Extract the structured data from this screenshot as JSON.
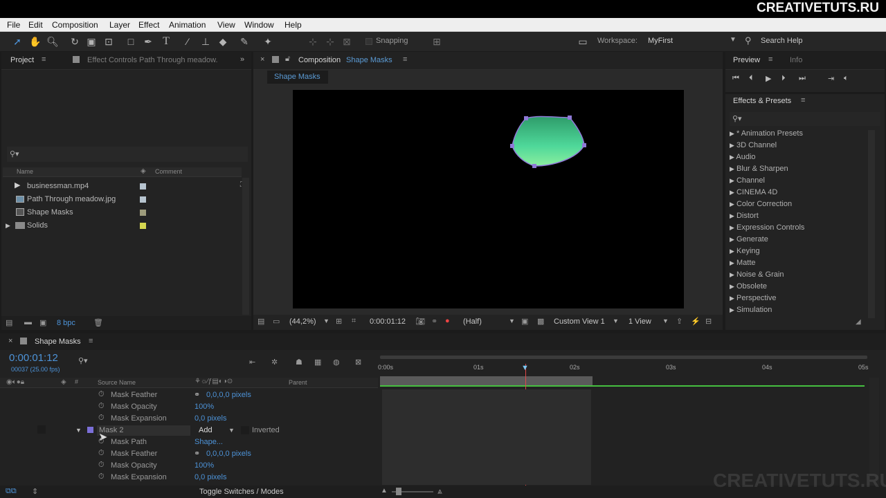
{
  "watermark_top": "CREATIVETUTS.RU",
  "watermark_bottom": "CREATIVETUTS.RU",
  "menu": [
    "File",
    "Edit",
    "Composition",
    "Layer",
    "Effect",
    "Animation",
    "View",
    "Window",
    "Help"
  ],
  "toolbar": {
    "snapping_label": "Snapping",
    "workspace_label": "Workspace:",
    "workspace_value": "MyFirst",
    "search_help": "Search Help"
  },
  "project": {
    "tab_project": "Project",
    "tab_effect_controls": "Effect Controls Path Through meadow.",
    "col_name": "Name",
    "col_comment": "Comment",
    "items": [
      {
        "name": "businessman.mp4",
        "color": "#b7c4cf"
      },
      {
        "name": "Path Through meadow.jpg",
        "color": "#b7c4cf"
      },
      {
        "name": "Shape Masks",
        "color": "#9e9c7c"
      },
      {
        "name": "Solids",
        "color": "#d5d650"
      }
    ],
    "bpc": "8 bpc"
  },
  "composition": {
    "tab_prefix": "Composition",
    "tab_name": "Shape Masks",
    "sub_tab": "Shape Masks",
    "zoom": "(44,2%)",
    "timecode": "0:00:01:12",
    "resolution": "(Half)",
    "view": "Custom View 1",
    "views": "1 View"
  },
  "preview": {
    "tab_preview": "Preview",
    "tab_info": "Info"
  },
  "effects": {
    "title": "Effects & Presets",
    "items": [
      "* Animation Presets",
      "3D Channel",
      "Audio",
      "Blur & Sharpen",
      "Channel",
      "CINEMA 4D",
      "Color Correction",
      "Distort",
      "Expression Controls",
      "Generate",
      "Keying",
      "Matte",
      "Noise & Grain",
      "Obsolete",
      "Perspective",
      "Simulation"
    ]
  },
  "timeline": {
    "tab": "Shape Masks",
    "timecode": "0:00:01:12",
    "fps": "00037 (25.00 fps)",
    "col_source": "Source Name",
    "col_parent": "Parent",
    "ruler": [
      "0:00s",
      "01s",
      "02s",
      "03s",
      "04s",
      "05s"
    ],
    "rows": [
      {
        "label": "Mask Feather",
        "value": "0,0,0,0 pixels"
      },
      {
        "label": "Mask Opacity",
        "value": "100%"
      },
      {
        "label": "Mask Expansion",
        "value": "0,0 pixels"
      }
    ],
    "mask2": {
      "label": "Mask 2",
      "mode": "Add",
      "inverted": "Inverted"
    },
    "rows2": [
      {
        "label": "Mask Path",
        "value": "Shape..."
      },
      {
        "label": "Mask Feather",
        "value": "0,0,0,0 pixels"
      },
      {
        "label": "Mask Opacity",
        "value": "100%"
      },
      {
        "label": "Mask Expansion",
        "value": "0,0 pixels"
      }
    ],
    "toggle": "Toggle Switches / Modes"
  }
}
